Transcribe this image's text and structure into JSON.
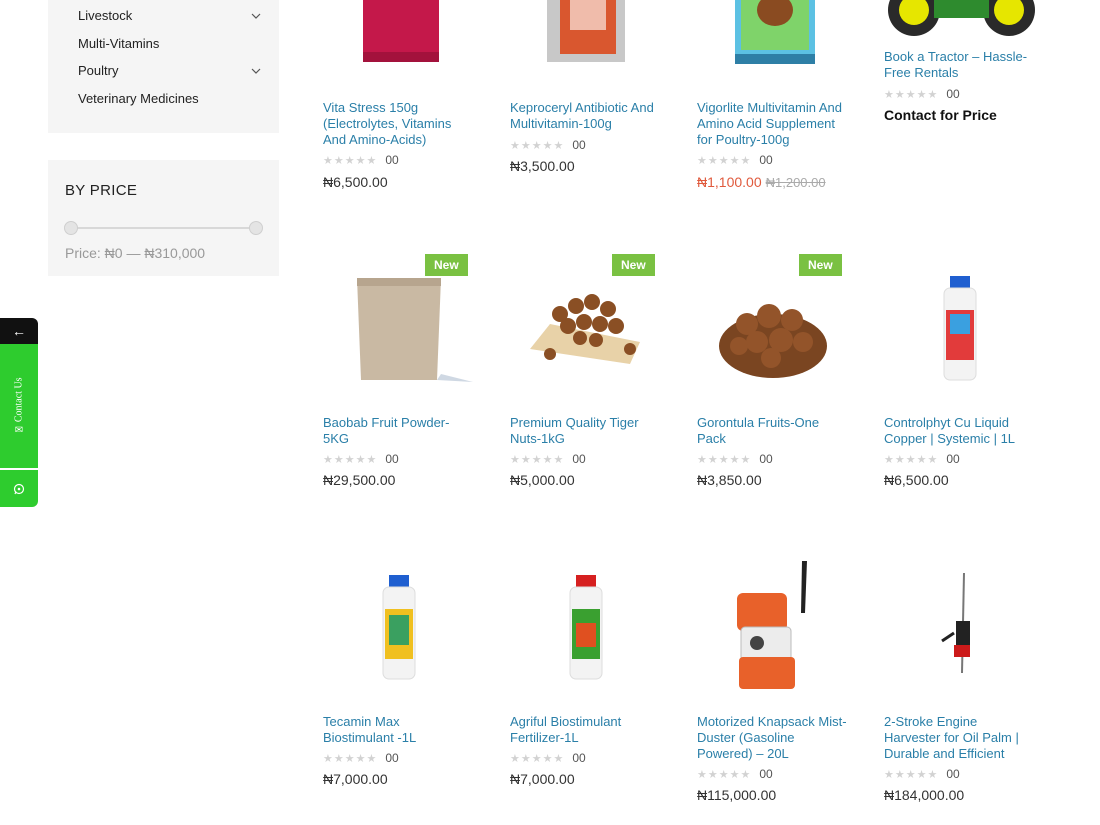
{
  "sidebar": {
    "categories": [
      {
        "label": "Livestock",
        "expandable": true
      },
      {
        "label": "Multi-Vitamins",
        "expandable": false
      },
      {
        "label": "Poultry",
        "expandable": true
      },
      {
        "label": "Veterinary Medicines",
        "expandable": false
      }
    ],
    "price_filter": {
      "title": "BY PRICE",
      "label": "Price: ₦0 — ₦310,000"
    }
  },
  "floating": {
    "back_label": "←",
    "contact_label": "Contact Us"
  },
  "products": [
    {
      "title": "Vita Stress 150g (Electrolytes, Vitamins And Amino-Acids)",
      "rating": "00",
      "price": "₦6,500.00",
      "badge": ""
    },
    {
      "title": "Keproceryl Antibiotic And Multivitamin-100g",
      "rating": "00",
      "price": "₦3,500.00",
      "badge": ""
    },
    {
      "title": "Vigorlite Multivitamin And Amino Acid Supplement for Poultry-100g",
      "rating": "00",
      "price": "₦1,100.00",
      "old_price": "₦1,200.00",
      "badge": ""
    },
    {
      "title": "Book a Tractor – Hassle-Free Rentals",
      "rating": "00",
      "price": "Contact for Price",
      "badge": ""
    },
    {
      "title": "Baobab Fruit Powder-5KG",
      "rating": "00",
      "price": "₦29,500.00",
      "badge": "New"
    },
    {
      "title": "Premium Quality Tiger Nuts-1kG",
      "rating": "00",
      "price": "₦5,000.00",
      "badge": "New"
    },
    {
      "title": "Gorontula Fruits-One Pack",
      "rating": "00",
      "price": "₦3,850.00",
      "badge": "New"
    },
    {
      "title": "Controlphyt Cu Liquid Copper | Systemic | 1L",
      "rating": "00",
      "price": "₦6,500.00",
      "badge": ""
    },
    {
      "title": "Tecamin Max Biostimulant -1L",
      "rating": "00",
      "price": "₦7,000.00",
      "badge": ""
    },
    {
      "title": "Agriful Biostimulant Fertilizer-1L",
      "rating": "00",
      "price": "₦7,000.00",
      "badge": ""
    },
    {
      "title": "Motorized Knapsack Mist-Duster (Gasoline Powered) – 20L",
      "rating": "00",
      "price": "₦115,000.00",
      "badge": ""
    },
    {
      "title": "2-Stroke Engine Harvester for Oil Palm | Durable and Efficient",
      "rating": "00",
      "price": "₦184,000.00",
      "badge": ""
    }
  ],
  "colors": {
    "link": "#2a7fa8",
    "badge": "#7ac142",
    "sale": "#e05a3d",
    "contact_tab": "#2ecc2e"
  }
}
